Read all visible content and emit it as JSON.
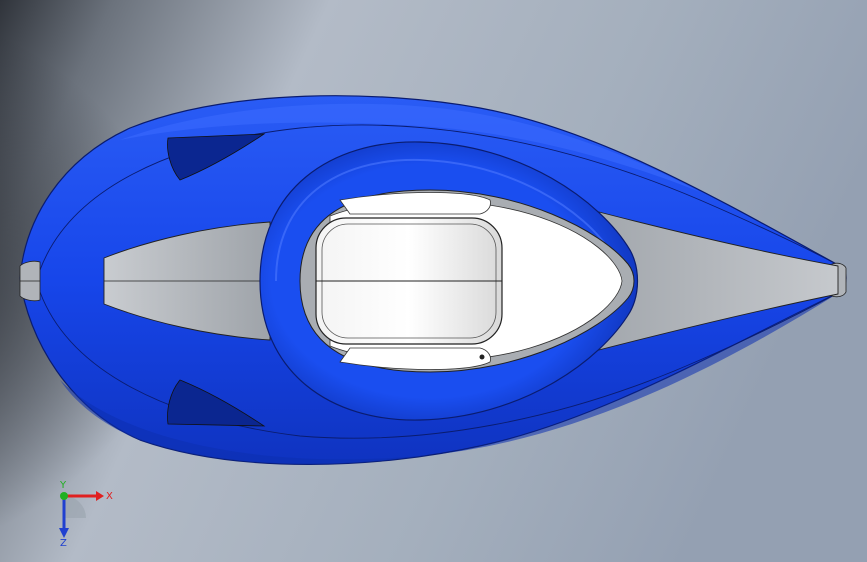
{
  "viewport": {
    "background_top_color": "#c8d0dc",
    "background_left_color": "#2a2d33",
    "background_right_color": "#9aa7b8"
  },
  "model": {
    "body_color": "#1746ea",
    "body_dark_color": "#0f33b8",
    "trim_color": "#b4b8bd",
    "canopy_color": "#ffffff"
  },
  "triad": {
    "x_label": "X",
    "y_label": "Y",
    "z_label": "Z",
    "x_color": "#e02020",
    "y_color": "#20b020",
    "z_color": "#2040d0"
  }
}
